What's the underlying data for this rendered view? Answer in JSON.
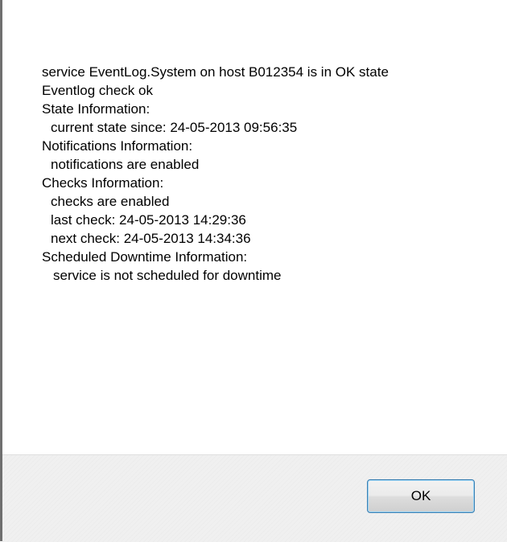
{
  "message": {
    "lines": [
      "service EventLog.System on host B012354 is in OK state",
      "Eventlog check ok",
      "State Information:",
      "current state since: 24-05-2013 09:56:35",
      "Notifications Information:",
      "notifications are enabled",
      "Checks Information:",
      "checks are enabled",
      "last check: 24-05-2013 14:29:36",
      "next check: 24-05-2013 14:34:36",
      "Scheduled Downtime Information:",
      "service is not scheduled for downtime"
    ]
  },
  "buttons": {
    "ok_label": "OK"
  }
}
